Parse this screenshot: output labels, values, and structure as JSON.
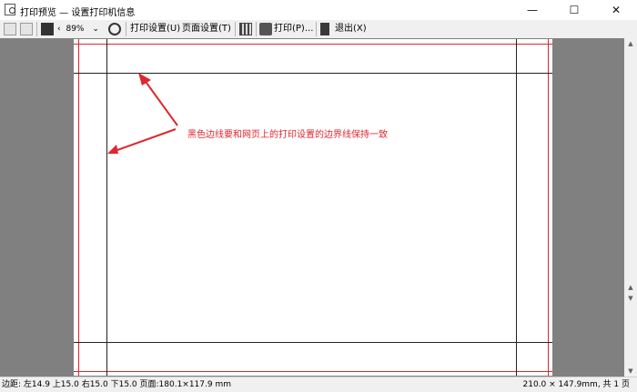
{
  "window": {
    "title": "打印预览 — 设置打印机信息"
  },
  "toolbar": {
    "zoom_value": "89%",
    "print_setup_label": "打印设置(U)",
    "page_setup_label": "页面设置(T)",
    "print_label": "打印(P)...",
    "exit_label": "退出(X)"
  },
  "annotation": {
    "text": "黑色边线要和网页上的打印设置的边界线保持一致",
    "color": "#e0262f"
  },
  "status": {
    "margins": "边距: 左14.9 上15.0 右15.0 下15.0 页面:180.1×117.9 mm",
    "page_info": "210.0 × 147.9mm, 共 1 页"
  },
  "colors": {
    "margin_line": "#222222",
    "print_boundary": "#e0262f",
    "background": "#808080"
  }
}
